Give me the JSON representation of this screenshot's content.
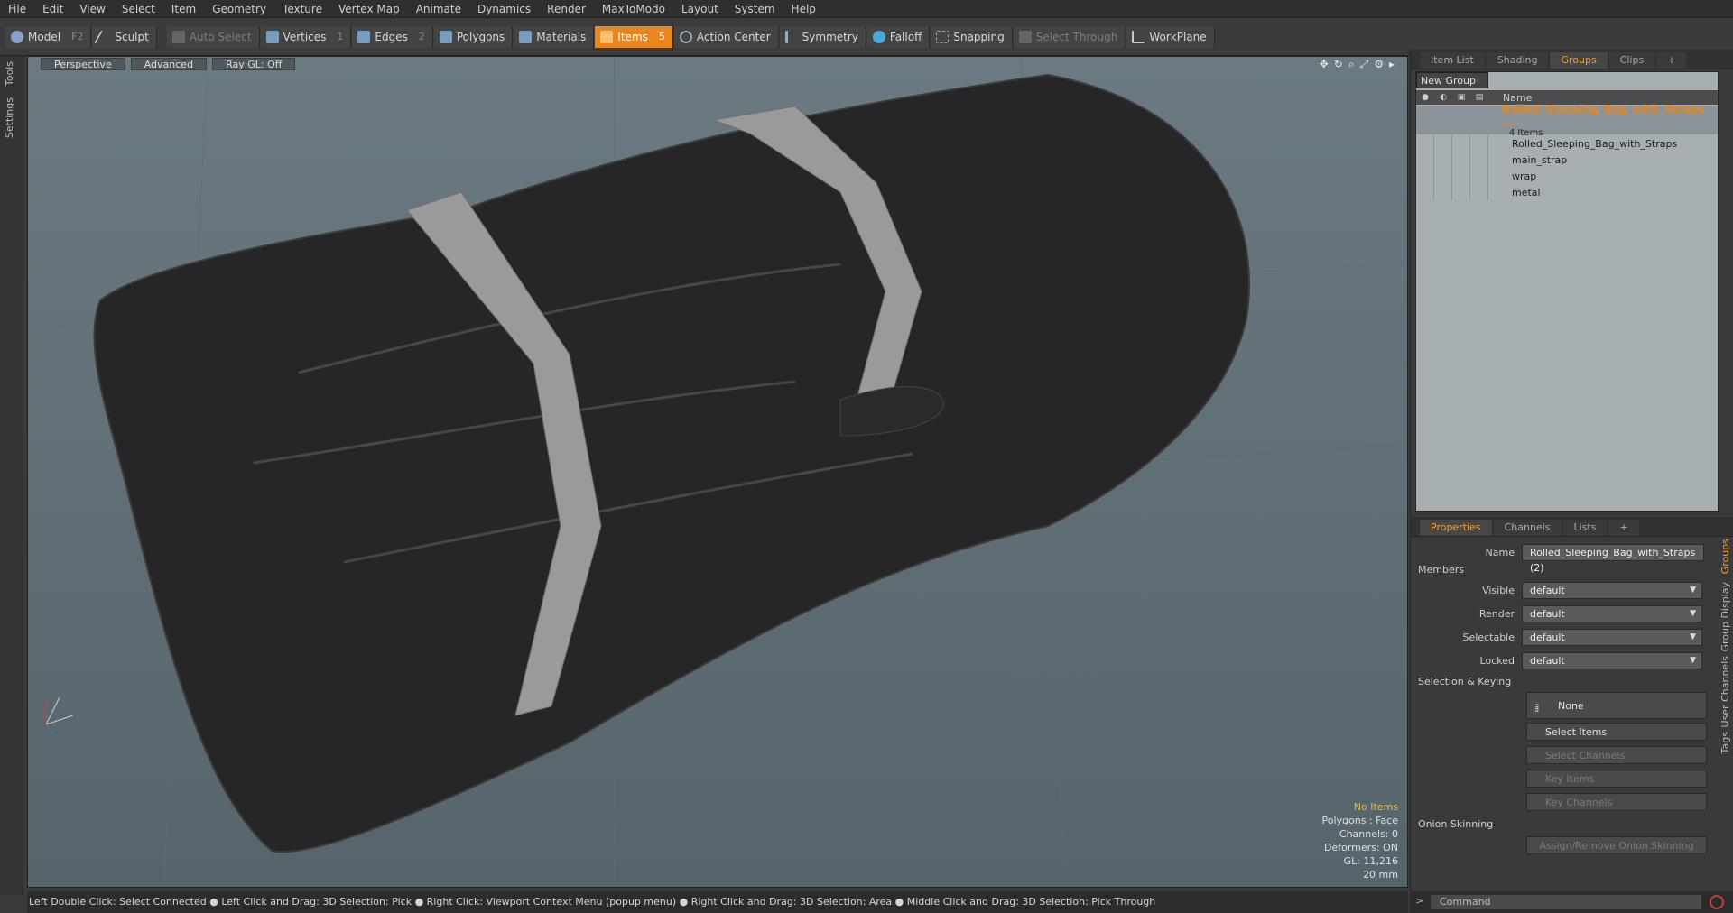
{
  "menu": [
    "File",
    "Edit",
    "View",
    "Select",
    "Item",
    "Geometry",
    "Texture",
    "Vertex Map",
    "Animate",
    "Dynamics",
    "Render",
    "MaxToModo",
    "Layout",
    "System",
    "Help"
  ],
  "toolbar": {
    "model": "Model",
    "model_key": "F2",
    "sculpt": "Sculpt",
    "auto_select": "Auto Select",
    "vertices": "Vertices",
    "vertices_key": "1",
    "edges": "Edges",
    "edges_key": "2",
    "polygons": "Polygons",
    "materials": "Materials",
    "items": "Items",
    "items_key": "5",
    "action_center": "Action Center",
    "symmetry": "Symmetry",
    "falloff": "Falloff",
    "snapping": "Snapping",
    "select_through": "Select Through",
    "workplane": "WorkPlane"
  },
  "left_tabs": [
    "Tools",
    "Settings"
  ],
  "viewport": {
    "view": "Perspective",
    "advanced": "Advanced",
    "raygl": "Ray GL: Off",
    "info": {
      "items": "No Items",
      "polygons": "Polygons : Face",
      "channels": "Channels: 0",
      "deformers": "Deformers: ON",
      "gl": "GL: 11,216",
      "scale": "20 mm"
    }
  },
  "status": "Left Double Click: Select Connected ● Left Click and Drag: 3D Selection: Pick ● Right Click: Viewport Context Menu (popup menu) ● Right Click and Drag: 3D Selection: Area ● Middle Click and Drag: 3D Selection: Pick Through",
  "top_tabs": [
    "Item List",
    "Shading",
    "Groups",
    "Clips"
  ],
  "groups": {
    "new_group": "New Group",
    "name_header": "Name",
    "root": {
      "name": "Rolled_Sleeping_Bag_with_Straps ...",
      "count": "4 Items"
    },
    "children": [
      "Rolled_Sleeping_Bag_with_Straps",
      "main_strap",
      "wrap",
      "metal"
    ]
  },
  "prop_tabs": [
    "Properties",
    "Channels",
    "Lists"
  ],
  "properties": {
    "name_label": "Name",
    "name_value": "Rolled_Sleeping_Bag_with_Straps (2)",
    "members": "Members",
    "visible_label": "Visible",
    "visible_value": "default",
    "render_label": "Render",
    "render_value": "default",
    "selectable_label": "Selectable",
    "selectable_value": "default",
    "locked_label": "Locked",
    "locked_value": "default",
    "selection_keying": "Selection & Keying",
    "none": "None",
    "select_items": "Select Items",
    "select_channels": "Select Channels",
    "key_items": "Key Items",
    "key_channels": "Key Channels",
    "onion": "Onion Skinning",
    "assign_onion": "Assign/Remove Onion Skinning"
  },
  "side_tabs": [
    "Groups",
    "Group Display",
    "User Channels",
    "Tags"
  ],
  "command_placeholder": "Command"
}
